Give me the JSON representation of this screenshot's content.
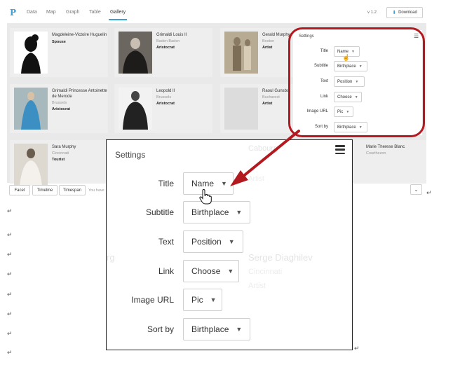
{
  "app": {
    "logo": "P",
    "tabs": [
      {
        "label": "Data",
        "active": false
      },
      {
        "label": "Map",
        "active": false
      },
      {
        "label": "Graph",
        "active": false
      },
      {
        "label": "Table",
        "active": false
      },
      {
        "label": "Gallery",
        "active": true
      }
    ],
    "version": "v 1.2",
    "download_label": "Download"
  },
  "gallery": {
    "cards": [
      {
        "name": "Magdeleine-Victoire Huguelin",
        "place": "",
        "role": "Spouse"
      },
      {
        "name": "Grimaldi Louis II",
        "place": "Baden Baden",
        "role": "Aristocrat"
      },
      {
        "name": "Gerald Murphy",
        "place": "Boston",
        "role": "Artist"
      },
      {
        "name": "Grimaldi Princesse Antoinette de Merode",
        "place": "Brussels",
        "role": "Aristocrat"
      },
      {
        "name": "Leopold II",
        "place": "Brussels",
        "role": "Aristocrat"
      },
      {
        "name": "Raoul Gunsbo",
        "place": "Bucharest",
        "role": "Artist"
      },
      {
        "name": "Sara Murphy",
        "place": "Cincinnati",
        "role": "Tourist"
      },
      {
        "name": "Marie Therese Blanc",
        "place": "Courthezon",
        "role": ""
      }
    ]
  },
  "bottombar": {
    "buttons": [
      "Facet",
      "Timeline",
      "Timespan"
    ],
    "status": "You have"
  },
  "settings": {
    "title": "Settings",
    "rows": [
      {
        "label": "Title",
        "value": "Name"
      },
      {
        "label": "Subtitle",
        "value": "Birthplace"
      },
      {
        "label": "Text",
        "value": "Position"
      },
      {
        "label": "Link",
        "value": "Choose"
      },
      {
        "label": "Image URL",
        "value": "Pic"
      },
      {
        "label": "Sort by",
        "value": "Birthplace"
      }
    ]
  },
  "zoom_ghosts": {
    "place1": "Cabourg",
    "text1": "Artist",
    "name2": "Serge Diaghilev",
    "place2": "Cincinnati",
    "text2": "Artist",
    "left_fragment": "rg"
  },
  "colors": {
    "accent": "#3aa0d8",
    "annotation_red": "#b21a20"
  },
  "icons": {
    "menu": "hamburger-menu-icon",
    "caret": "caret-down-icon",
    "cursor": "hand-pointer-icon",
    "download": "download-icon",
    "chevron": "chevron-down-icon",
    "return": "return-mark-icon"
  }
}
